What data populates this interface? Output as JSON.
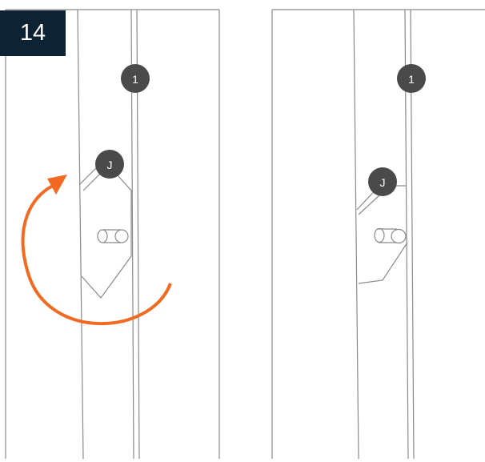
{
  "step": {
    "number": "14"
  },
  "callouts": {
    "left_top": "1",
    "left_mid": "J",
    "right_top": "1",
    "right_mid": "J"
  },
  "colors": {
    "badge_bg": "#0d2233",
    "callout_fill": "#4a4a4a",
    "callout_text": "#ffffff",
    "rotation_arrow": "#f26a21",
    "line": "#8a8a8a"
  },
  "icons": {
    "rotation": "rotate-clockwise-arrow-icon"
  }
}
